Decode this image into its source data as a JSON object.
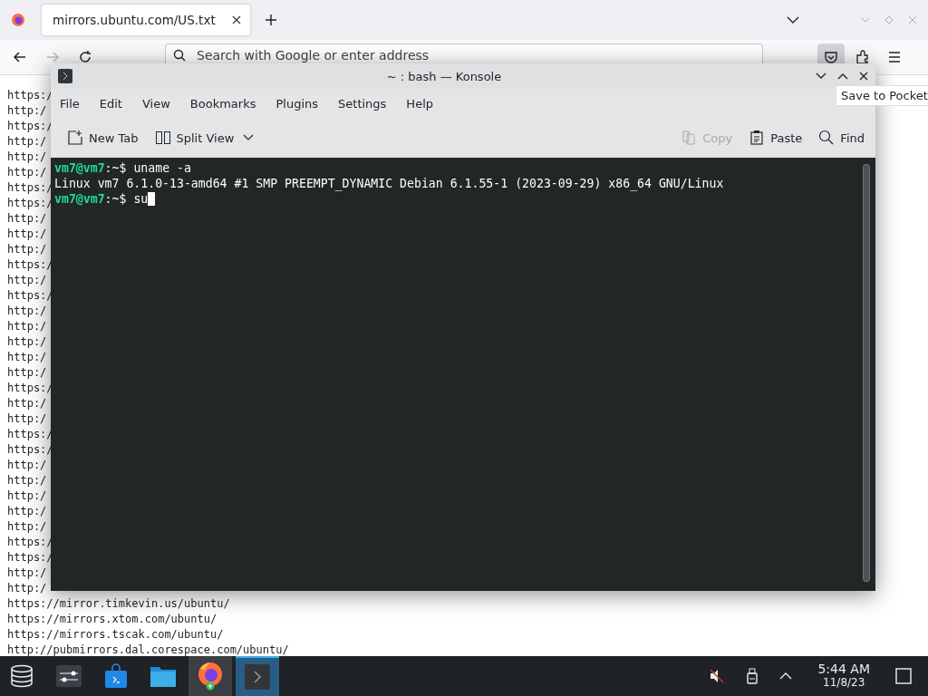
{
  "browser": {
    "tab": {
      "title": "mirrors.ubuntu.com/US.txt",
      "selected": true
    },
    "address_bar": {
      "placeholder": "Search with Google or enter address"
    },
    "tooltip": "Save to Pocket",
    "page_lines": [
      "https:/",
      "http:/",
      "https:/",
      "http:/",
      "http:/",
      "http:/",
      "https:/",
      "https:/",
      "http:/",
      "http:/",
      "http:/",
      "https:/",
      "http:/",
      "https:/",
      "http:/",
      "http:/",
      "http:/",
      "http:/",
      "http:/",
      "https:/",
      "http:/",
      "http:/",
      "https:/",
      "https:/",
      "http:/",
      "http:/",
      "http:/",
      "http:/",
      "http:/",
      "https:/",
      "https:/",
      "http:/",
      "http:/",
      "https://mirror.timkevin.us/ubuntu/",
      "https://mirrors.xtom.com/ubuntu/",
      "https://mirrors.tscak.com/ubuntu/",
      "http://pubmirrors.dal.corespace.com/ubuntu/"
    ]
  },
  "konsole": {
    "title": "~ : bash — Konsole",
    "menu": [
      "File",
      "Edit",
      "View",
      "Bookmarks",
      "Plugins",
      "Settings",
      "Help"
    ],
    "toolbar_left": [
      {
        "kind": "new-tab",
        "label": "New Tab",
        "disabled": false
      },
      {
        "kind": "split-view",
        "label": "Split View",
        "disabled": false
      }
    ],
    "toolbar_right": [
      {
        "kind": "copy",
        "label": "Copy",
        "disabled": true
      },
      {
        "kind": "paste",
        "label": "Paste",
        "disabled": false
      },
      {
        "kind": "find",
        "label": "Find",
        "disabled": false
      }
    ],
    "terminal": [
      {
        "kind": "prompt",
        "user_host": "vm7@vm7",
        "path": ":~$",
        "command": "uname -a",
        "cursor": false
      },
      {
        "kind": "output",
        "text": "Linux vm7 6.1.0-13-amd64 #1 SMP PREEMPT_DYNAMIC Debian 6.1.55-1 (2023-09-29) x86_64 GNU/Linux"
      },
      {
        "kind": "prompt",
        "user_host": "vm7@vm7",
        "path": ":~$",
        "command": "su",
        "cursor": true
      }
    ]
  },
  "taskbar": {
    "apps": [
      {
        "kind": "launcher",
        "selected": false,
        "hovered": false
      },
      {
        "kind": "settings",
        "selected": false,
        "hovered": false
      },
      {
        "kind": "store",
        "selected": false,
        "hovered": false
      },
      {
        "kind": "files",
        "selected": false,
        "hovered": false
      },
      {
        "kind": "firefox",
        "selected": false,
        "hovered": true
      },
      {
        "kind": "konsole",
        "selected": true,
        "hovered": false
      }
    ],
    "tray": {
      "muted": true,
      "time": "5:44 AM",
      "date": "11/8/23"
    }
  }
}
